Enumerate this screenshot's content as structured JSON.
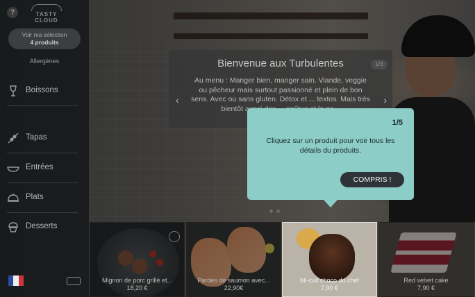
{
  "sidebar": {
    "logo_text": "TASTY CLOUD",
    "selection_label": "Voir ma sélection",
    "selection_count": "4 produits",
    "allergens_label": "Allergènes",
    "nav": [
      {
        "label": "Boissons",
        "icon": "glass-icon"
      },
      {
        "label": "Tapas",
        "icon": "skewer-icon"
      },
      {
        "label": "Entrées",
        "icon": "bowl-icon"
      },
      {
        "label": "Plats",
        "icon": "cloche-icon"
      },
      {
        "label": "Desserts",
        "icon": "cupcake-icon"
      }
    ],
    "language_icon": "french-flag-icon",
    "seat_icon": "sofa-icon"
  },
  "welcome": {
    "title": "Bienvenue aux Turbulentes",
    "page": "1/3",
    "text": "Au menu : Manger bien, manger sain. Viande, veggie ou pêcheur mais surtout passionné et plein de bon sens. Avec ou sans gluten. Détox et ... textos. Mais très bientôt aussi des ... goûtus et la pe..."
  },
  "tooltip": {
    "step": "1/5",
    "text": "Cliquez sur un produit pour voir tous les détails du produits.",
    "button": "COMPRIS !"
  },
  "products": [
    {
      "name": "Mignon de porc grillé et...",
      "price": "18,20 €"
    },
    {
      "name": "Pardes de saumon avec...",
      "price": "22,90€"
    },
    {
      "name": "Mi-cuit choco du chef",
      "price": "7,90 €"
    },
    {
      "name": "Red velvet cake",
      "price": "7,90 €"
    }
  ],
  "colors": {
    "tooltip_bg": "#8ccdc7",
    "button_bg": "#2d3338",
    "sidebar_bg": "#141618"
  }
}
